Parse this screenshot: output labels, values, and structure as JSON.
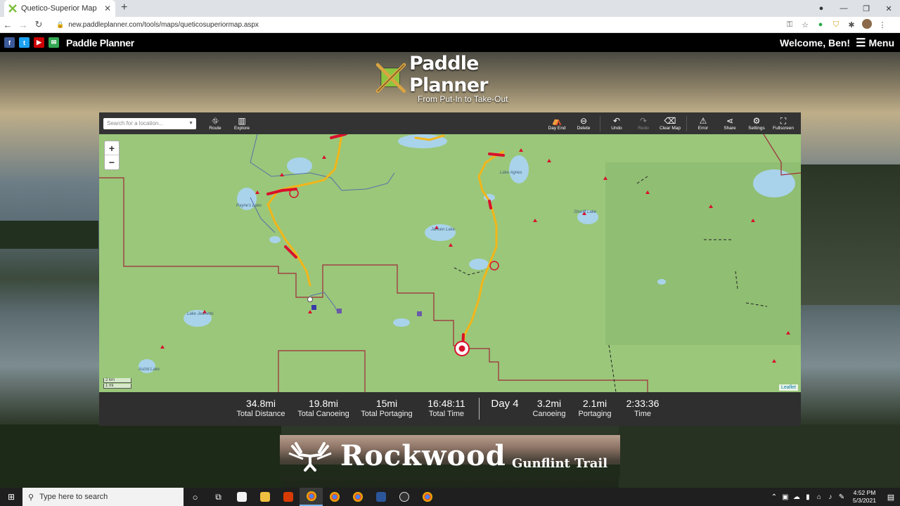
{
  "browser": {
    "tab_title": "Quetico-Superior Map",
    "tab_close": "✕",
    "new_tab": "+",
    "url": "new.paddleplanner.com/tools/maps/queticosuperiormap.aspx",
    "window_controls": {
      "minimize": "—",
      "maximize": "❐",
      "close": "✕"
    }
  },
  "site": {
    "brand": "Paddle Planner",
    "welcome": "Welcome, Ben!",
    "menu": "Menu",
    "social": [
      "f",
      "t",
      "▶",
      "✉"
    ]
  },
  "logo": {
    "title": "Paddle Planner",
    "tagline": "From Put-In to Take-Out"
  },
  "map_toolbar": {
    "search_placeholder": "Search for a location...",
    "left_buttons": [
      {
        "label": "Route",
        "icon": "route-icon"
      },
      {
        "label": "Explore",
        "icon": "map-icon"
      }
    ],
    "right_buttons": [
      {
        "label": "Day End",
        "icon": "tent-icon"
      },
      {
        "label": "Delete",
        "icon": "minus-circle-icon"
      },
      {
        "label": "Undo",
        "icon": "undo-icon"
      },
      {
        "label": "Redo",
        "icon": "redo-icon"
      },
      {
        "label": "Clear Map",
        "icon": "eraser-icon"
      },
      {
        "label": "Error",
        "icon": "warning-icon"
      },
      {
        "label": "Share",
        "icon": "share-icon"
      },
      {
        "label": "Settings",
        "icon": "gear-icon"
      },
      {
        "label": "Fullscreen",
        "icon": "fullscreen-icon"
      }
    ]
  },
  "map": {
    "zoom_in": "+",
    "zoom_out": "−",
    "scale_km": "2 km",
    "scale_mi": "1 mi",
    "attribution": "Leaflet",
    "labels": [
      "Lake Agnes",
      "Sheriff Lake",
      "Payne's Lake",
      "Lake Jeanette",
      "Astrid Lake",
      "Jansen Lake"
    ]
  },
  "stats": {
    "total_distance": {
      "value": "34.8mi",
      "label": "Total Distance"
    },
    "total_canoeing": {
      "value": "19.8mi",
      "label": "Total Canoeing"
    },
    "total_portaging": {
      "value": "15mi",
      "label": "Total Portaging"
    },
    "total_time": {
      "value": "16:48:11",
      "label": "Total Time"
    },
    "day": "Day 4",
    "canoeing": {
      "value": "3.2mi",
      "label": "Canoeing"
    },
    "portaging": {
      "value": "2.1mi",
      "label": "Portaging"
    },
    "time": {
      "value": "2:33:36",
      "label": "Time"
    }
  },
  "banner": {
    "name": "Rockwood",
    "subtitle": "Gunflint Trail"
  },
  "taskbar": {
    "search_placeholder": "Type here to search",
    "time": "4:52 PM",
    "date": "5/3/2021"
  },
  "colors": {
    "map_land": "#9ac77a",
    "water": "#a9d3ea",
    "route_yellow": "#f2b61a",
    "route_red": "#d8112c",
    "boundary": "#a0283a"
  }
}
